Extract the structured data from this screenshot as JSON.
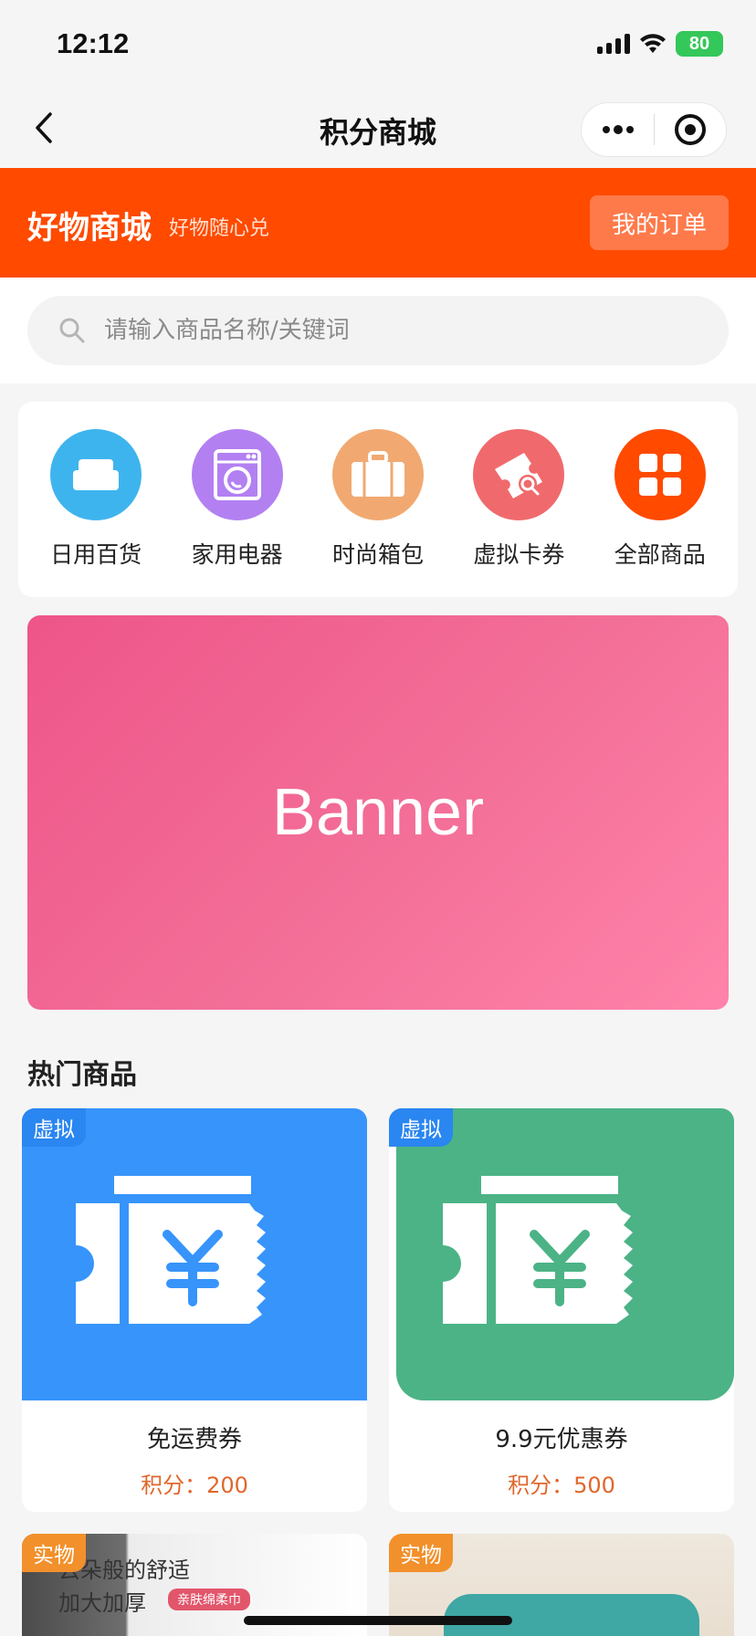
{
  "status_bar": {
    "time": "12:12",
    "battery": "80"
  },
  "nav": {
    "title": "积分商城"
  },
  "mall_header": {
    "title": "好物商城",
    "subtitle": "好物随心兑",
    "orders_label": "我的订单"
  },
  "search": {
    "placeholder": "请输入商品名称/关键词",
    "value": ""
  },
  "categories": [
    {
      "label": "日用百货",
      "icon": "sofa-icon",
      "color": "#3eb4ee"
    },
    {
      "label": "家用电器",
      "icon": "washing-machine-icon",
      "color": "#b380f2"
    },
    {
      "label": "时尚箱包",
      "icon": "suitcase-icon",
      "color": "#f1a971"
    },
    {
      "label": "虚拟卡券",
      "icon": "ticket-search-icon",
      "color": "#f06a6d"
    },
    {
      "label": "全部商品",
      "icon": "grid-icon",
      "color": "#ff4a00"
    }
  ],
  "banner": {
    "text": "Banner"
  },
  "hot_section": {
    "title": "热门商品"
  },
  "products": [
    {
      "tag": "虚拟",
      "name": "免运费券",
      "points": "积分：200",
      "bg": "#3794fb",
      "tag_color": "#2a86f0"
    },
    {
      "tag": "虚拟",
      "name": "9.9元优惠券",
      "points": "积分：500",
      "bg": "#4cb386",
      "tag_color": "#2a86f0"
    },
    {
      "tag": "实物",
      "img_text1": "云朵般的舒适",
      "img_text2": "加大加厚",
      "img_badge": "亲肤绵柔巾",
      "tag_color": "#f2902b"
    },
    {
      "tag": "实物",
      "tag_color": "#f2902b"
    }
  ]
}
